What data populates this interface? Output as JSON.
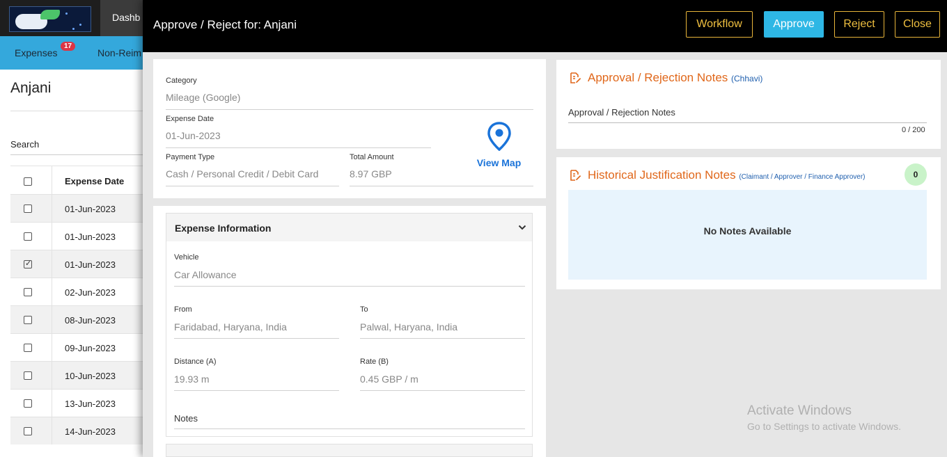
{
  "background": {
    "nav_dashboard": "Dashb",
    "nav_expenses": "Expenses",
    "expenses_badge": "17",
    "nav_nonreim": "Non-Reim",
    "page_title": "Anjani",
    "search_label": "Search",
    "table": {
      "header": "Expense Date",
      "rows": [
        {
          "date": "01-Jun-2023",
          "checked": false
        },
        {
          "date": "01-Jun-2023",
          "checked": false
        },
        {
          "date": "01-Jun-2023",
          "checked": true
        },
        {
          "date": "02-Jun-2023",
          "checked": false
        },
        {
          "date": "08-Jun-2023",
          "checked": false
        },
        {
          "date": "09-Jun-2023",
          "checked": false
        },
        {
          "date": "10-Jun-2023",
          "checked": false
        },
        {
          "date": "13-Jun-2023",
          "checked": false
        },
        {
          "date": "14-Jun-2023",
          "checked": false
        }
      ]
    }
  },
  "modal": {
    "title": "Approve / Reject for: Anjani",
    "buttons": {
      "workflow": "Workflow",
      "approve": "Approve",
      "reject": "Reject",
      "close": "Close"
    },
    "summary": {
      "category_label": "Category",
      "category_value": "Mileage (Google)",
      "expense_date_label": "Expense Date",
      "expense_date_value": "01-Jun-2023",
      "payment_type_label": "Payment Type",
      "payment_type_value": "Cash / Personal Credit / Debit Card",
      "total_amount_label": "Total Amount",
      "total_amount_value": "8.97 GBP",
      "view_map": "View Map"
    },
    "expense_info": {
      "title": "Expense Information",
      "vehicle_label": "Vehicle",
      "vehicle_value": "Car Allowance",
      "from_label": "From",
      "from_value": "Faridabad, Haryana, India",
      "to_label": "To",
      "to_value": "Palwal, Haryana, India",
      "distance_label": "Distance (A)",
      "distance_value": "19.93 m",
      "rate_label": "Rate (B)",
      "rate_value": "0.45 GBP / m",
      "notes_label": "Notes"
    },
    "approval_notes": {
      "title": "Approval / Rejection Notes",
      "subtitle": "(Chhavi)",
      "field_label": "Approval / Rejection Notes",
      "counter": "0 / 200"
    },
    "historical_notes": {
      "title": "Historical Justification Notes",
      "subtitle": "(Claimant / Approver / Finance Approver)",
      "count": "0",
      "empty_text": "No Notes Available"
    }
  },
  "watermark": {
    "line1": "Activate Windows",
    "line2": "Go to Settings to activate Windows."
  },
  "colors": {
    "header_bg": "#000000",
    "accent_gold": "#f0c040",
    "approve_blue": "#2eb7e5",
    "section_orange": "#e0671a",
    "link_blue": "#1a73d9",
    "nav_blue": "#34a8dc"
  },
  "icons": {
    "calendar": "calendar-icon",
    "map_pin": "map-pin-icon",
    "chevron": "chevron-down-icon",
    "note": "edit-note-icon"
  }
}
